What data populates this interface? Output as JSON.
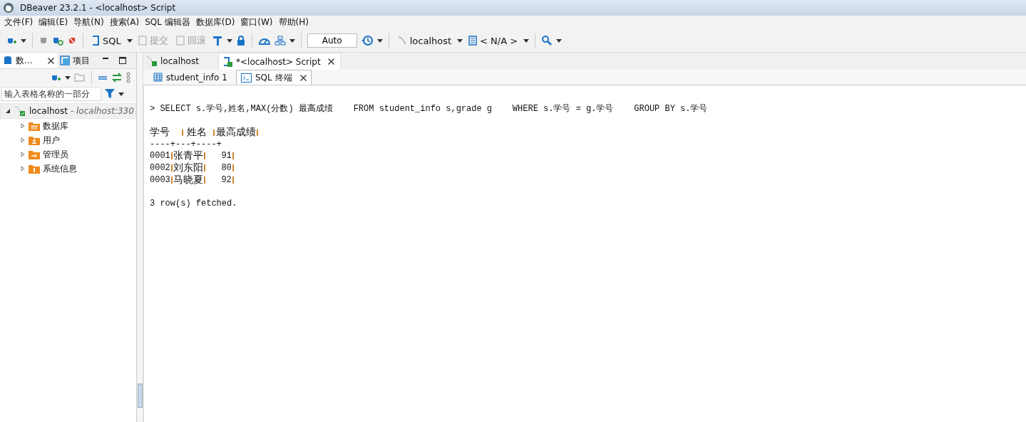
{
  "window": {
    "title": "DBeaver 23.2.1 - <localhost> Script"
  },
  "menu": [
    "文件(F)",
    "编辑(E)",
    "导航(N)",
    "搜索(A)",
    "SQL 编辑器",
    "数据库(D)",
    "窗口(W)",
    "帮助(H)"
  ],
  "toolbar": {
    "sql": "SQL",
    "commit": "提交",
    "rollback": "回滚",
    "transaction_mode": "Auto",
    "connection": "localhost",
    "schema": "< N/A >"
  },
  "left_panel": {
    "tabs": [
      {
        "label": "数...",
        "selected": true
      },
      {
        "label": "项目",
        "selected": false
      }
    ],
    "filter": {
      "placeholder": "输入表格名称的一部分"
    },
    "tree": [
      {
        "label": "localhost",
        "detail": "- localhost:330",
        "expanded": true,
        "children": [
          {
            "label": "数据库",
            "kind": "database",
            "expanded": false
          },
          {
            "label": "用户",
            "kind": "users",
            "expanded": false
          },
          {
            "label": "管理员",
            "kind": "admin",
            "expanded": false
          },
          {
            "label": "系统信息",
            "kind": "info",
            "expanded": false
          }
        ]
      }
    ]
  },
  "editor_tabs": [
    {
      "label": "localhost",
      "selected": false
    },
    {
      "label": "*<localhost> Script",
      "selected": true
    }
  ],
  "sub_tabs": [
    {
      "label": "student_info 1",
      "selected": false
    },
    {
      "label": "SQL 终端",
      "selected": true
    }
  ],
  "console": {
    "query": "> SELECT s.学号,姓名,MAX(分数) 最高成绩    FROM student_info s,grade g    WHERE s.学号 = g.学号    GROUP BY s.学号",
    "columns": [
      "学号",
      "姓名",
      "最高成绩"
    ],
    "separator": "----+---+----+",
    "rows": [
      [
        "0001",
        "张青平",
        "91"
      ],
      [
        "0002",
        "刘东阳",
        "80"
      ],
      [
        "0003",
        "马晓夏",
        "92"
      ]
    ],
    "footer": "3 row(s) fetched."
  }
}
